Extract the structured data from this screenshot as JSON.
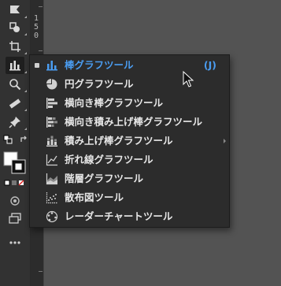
{
  "ruler": {
    "number": "150"
  },
  "flyout": {
    "items": [
      {
        "label": "棒グラフツール",
        "shortcut": "(J)",
        "selected": true,
        "icon": "bar-graph-icon"
      },
      {
        "label": "円グラフツール",
        "icon": "pie-graph-icon"
      },
      {
        "label": "横向き棒グラフツール",
        "icon": "horizontal-bar-graph-icon"
      },
      {
        "label": "横向き積み上げ棒グラフツール",
        "icon": "horizontal-stacked-bar-graph-icon"
      },
      {
        "label": "積み上げ棒グラフツール",
        "icon": "stacked-bar-graph-icon"
      },
      {
        "label": "折れ線グラフツール",
        "icon": "line-graph-icon"
      },
      {
        "label": "階層グラフツール",
        "icon": "area-graph-icon"
      },
      {
        "label": "散布図ツール",
        "icon": "scatter-graph-icon"
      },
      {
        "label": "レーダーチャートツール",
        "icon": "radar-graph-icon"
      }
    ]
  },
  "colors": {
    "selected_text": "#4a9cf0",
    "menu_text": "#e6e6e6",
    "panel_bg": "#2c2c2c",
    "toolbar_bg": "#323232"
  }
}
